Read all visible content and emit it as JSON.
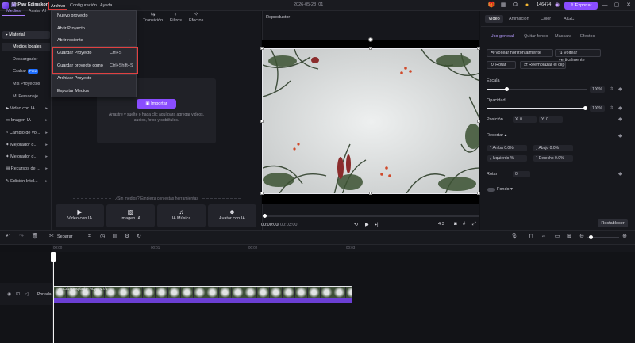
{
  "titlebar": {
    "app_name": "HitPaw Edimakor",
    "menus": [
      "Archivo",
      "Configuración",
      "Ayuda"
    ],
    "project_title": "2026-05-28_01",
    "credits": "146474",
    "export_label": "Exportar"
  },
  "left_tabs": {
    "media": "Medios",
    "avatar": "Avatar AI"
  },
  "sidebar": {
    "material": "Material",
    "local_media": "Medios locales",
    "downloader": "Descargador",
    "record": "Grabar",
    "record_badge": "Free",
    "my_projects": "Mis Proyectos",
    "my_character": "Mi Personaje",
    "video_ia": "Video con IA",
    "image_ia": "Imagen IA",
    "voice_change": "Cambio de vo...",
    "improve_1": "Mejorador d...",
    "improve_2": "Mejorador d...",
    "resources": "Recursos de ...",
    "smart_edit": "Edición Intel..."
  },
  "media_toolbar": {
    "transition": "Transición",
    "filters": "Filtros",
    "effects": "Efectos"
  },
  "import": {
    "button": "Importar",
    "hint": "Arrastre y suelte o haga clic aquí para agregar videos, audios, fotos y subtítulos."
  },
  "tools_hint": "¿Sin medios? Empieza con estas herramientas",
  "tools": [
    {
      "label": "Video con IA",
      "icon": "video-ai-icon"
    },
    {
      "label": "Imagen IA",
      "icon": "image-ai-icon"
    },
    {
      "label": "IA Música",
      "icon": "music-ai-icon"
    },
    {
      "label": "Avatar con IA",
      "icon": "avatar-ai-icon"
    }
  ],
  "dropdown": {
    "new_project": "Nuevo proyecto",
    "open_project": "Abrir Proyecto",
    "recent": "Abrir reciente",
    "save": "Guardar Proyecto",
    "save_shortcut": "Ctrl+S",
    "save_as": "Guardar proyecto como",
    "save_as_shortcut": "Ctrl+Shift+S",
    "archive": "Archivar Proyecto",
    "export_media": "Exportar Medios"
  },
  "player": {
    "title": "Reproductor",
    "time_current": "00:00:00",
    "time_total": "/ 00:03:00",
    "aspect": "4:3",
    "progress": 0
  },
  "props": {
    "tabs": [
      "Vídeo",
      "Animación",
      "Color",
      "AIGC"
    ],
    "subtabs": [
      "Uso general",
      "Quitar fondo",
      "Máscara",
      "Efectos"
    ],
    "flip_h": "Voltear horizontalmente",
    "flip_v": "Voltear verticalmente",
    "rotate": "Rotar",
    "replace_clip": "Reemplazar el clip",
    "scale_label": "Escala",
    "scale_value": "100%",
    "opacity_label": "Opacidad",
    "opacity_value": "100%",
    "position_label": "Posición",
    "pos_x_label": "X",
    "pos_x": "0",
    "pos_y_label": "Y",
    "pos_y": "0",
    "crop_label": "Recortar",
    "crop_top_label": "Arriba",
    "crop_top": "0.0%",
    "crop_bottom_label": "Abajo",
    "crop_bottom": "0.0%",
    "crop_left_label": "Izquierdo",
    "crop_left": "%",
    "crop_right_label": "Derecho",
    "crop_right": "0.0%",
    "rotate_label": "Rotar",
    "rotate_value": "0",
    "background_label": "Fondo",
    "reset": "Restablecer"
  },
  "timeline": {
    "split": "Separar",
    "ticks": [
      "00:00",
      "00:01",
      "00:02",
      "00:03"
    ],
    "track_name": "Portada",
    "clip_name": "3S Cdzi Unsplash - ЧОД8 V7/4"
  },
  "colors": {
    "accent": "#8a4dff",
    "highlight": "#e14141"
  }
}
